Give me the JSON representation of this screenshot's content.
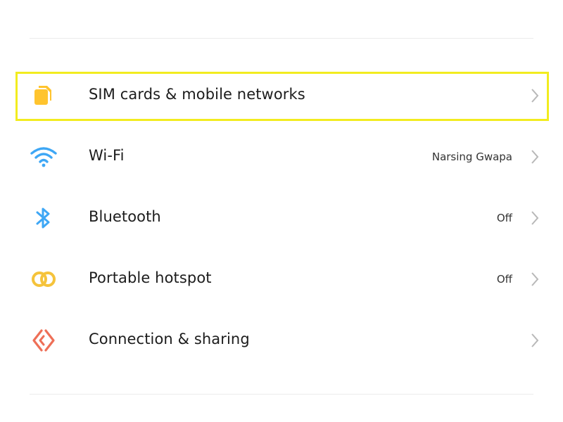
{
  "settings": {
    "items": [
      {
        "label": "SIM cards & mobile networks",
        "value": "",
        "icon": "sim-card-icon",
        "icon_color": "#ffc42e",
        "highlighted": true
      },
      {
        "label": "Wi-Fi",
        "value": "Narsing Gwapa",
        "icon": "wifi-icon",
        "icon_color": "#3ea7f5",
        "highlighted": false
      },
      {
        "label": "Bluetooth",
        "value": "Off",
        "icon": "bluetooth-icon",
        "icon_color": "#3ea7f5",
        "highlighted": false
      },
      {
        "label": "Portable hotspot",
        "value": "Off",
        "icon": "hotspot-icon",
        "icon_color": "#f5c33b",
        "highlighted": false
      },
      {
        "label": "Connection & sharing",
        "value": "",
        "icon": "connection-sharing-icon",
        "icon_color": "#ee6f57",
        "highlighted": false
      }
    ]
  },
  "colors": {
    "highlight_border": "#f2ec1f",
    "chevron": "#b8b8b8",
    "divider": "#ececec"
  }
}
